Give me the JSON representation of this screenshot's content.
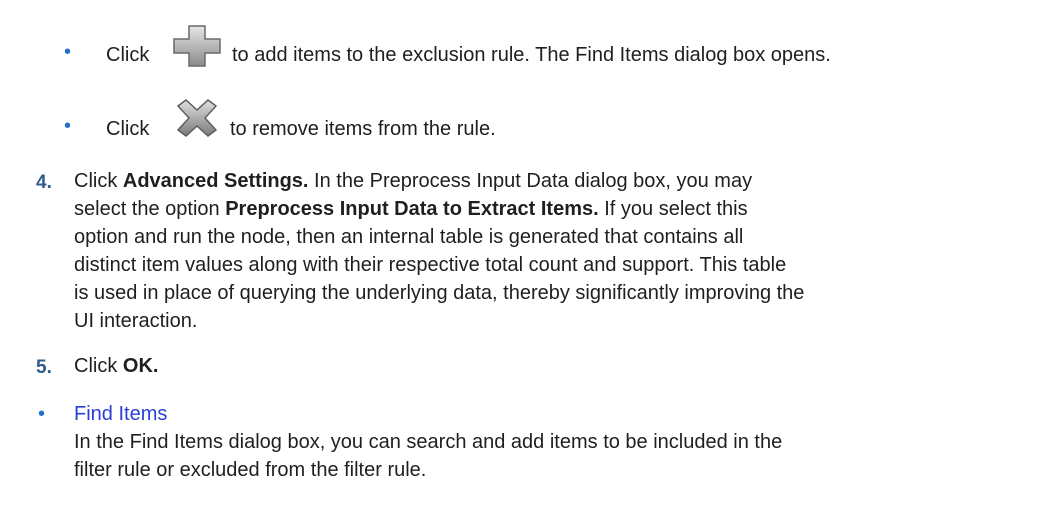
{
  "bullets_top": [
    {
      "prefix": "Click",
      "icon": "add-plus-icon",
      "suffix": "to add items to the exclusion rule. The Find Items dialog box opens."
    },
    {
      "prefix": "Click",
      "icon": "remove-x-icon",
      "suffix": "to remove items from the rule."
    }
  ],
  "step4": {
    "number": "4.",
    "l1_pre": "Click ",
    "l1_bold": "Advanced Settings.",
    "l1_post": " In the Preprocess Input Data dialog box, you may",
    "l2_pre": "select the option ",
    "l2_bold": "Preprocess Input Data to Extract Items.",
    "l2_post": " If you select this",
    "l3": "option and run the node, then an internal table is generated that contains all",
    "l4": "distinct item values along with their respective total count and support. This table",
    "l5": "is used in place of querying the underlying data, thereby significantly improving the",
    "l6": "UI interaction."
  },
  "step5": {
    "number": "5.",
    "pre": "Click ",
    "bold": "OK."
  },
  "find_items": {
    "link": "Find Items",
    "l1": "In the Find Items dialog box, you can search and add items to be included in the",
    "l2": "filter rule or excluded from the filter rule."
  },
  "colors": {
    "bullet": "#1e73c8",
    "step_number": "#2e5c8a",
    "link": "#2a3fd6"
  }
}
